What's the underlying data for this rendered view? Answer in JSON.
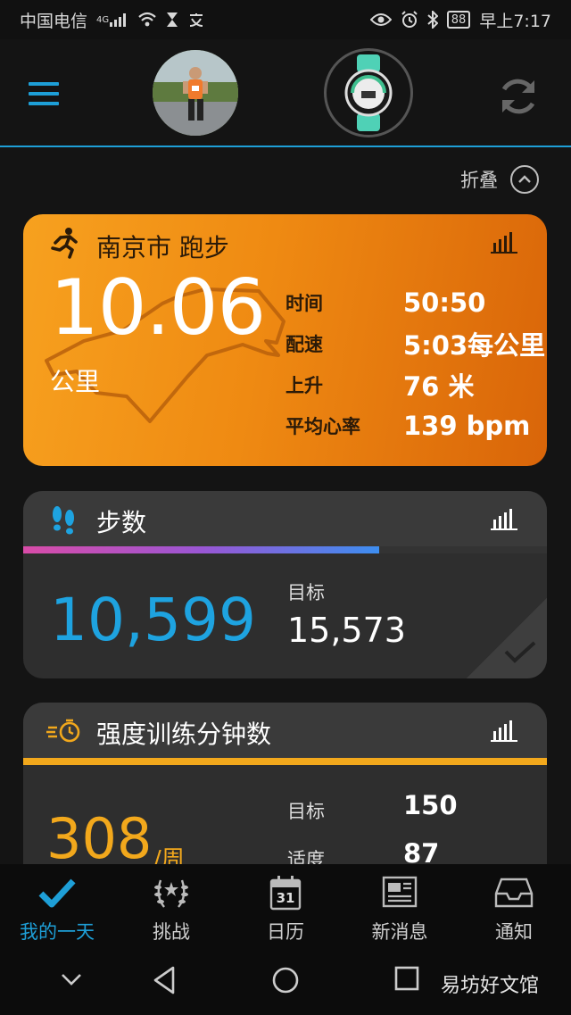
{
  "status_bar": {
    "carrier": "中国电信",
    "network": "4G",
    "battery": "88",
    "time": "早上7:17"
  },
  "header": {
    "menu_icon": "hamburger-icon",
    "sync_icon": "sync-icon"
  },
  "collapse": {
    "label": "折叠"
  },
  "run_card": {
    "title": "南京市 跑步",
    "distance": "10.06",
    "unit": "公里",
    "stats": [
      {
        "label": "时间",
        "value": "50:50"
      },
      {
        "label": "配速",
        "value": "5:03每公里"
      },
      {
        "label": "上升",
        "value": "76 米"
      },
      {
        "label": "平均心率",
        "value": "139 bpm"
      }
    ],
    "color": "#f39019"
  },
  "steps_card": {
    "title": "步数",
    "count": "10,599",
    "goal_label": "目标",
    "goal_value": "15,573",
    "progress": 0.68,
    "color": "#1ea3e0"
  },
  "intensity_card": {
    "title": "强度训练分钟数",
    "minutes": "308",
    "per": "/周",
    "rows": [
      {
        "label": "目标",
        "value": "150"
      },
      {
        "label": "适度",
        "value": "87"
      }
    ],
    "color": "#f2a81c"
  },
  "bottom_nav": [
    {
      "label": "我的一天",
      "icon": "check-icon",
      "active": true
    },
    {
      "label": "挑战",
      "icon": "laurel-icon",
      "active": false
    },
    {
      "label": "日历",
      "icon": "calendar-icon",
      "active": false,
      "day": "31"
    },
    {
      "label": "新消息",
      "icon": "newspaper-icon",
      "active": false
    },
    {
      "label": "通知",
      "icon": "inbox-icon",
      "active": false
    }
  ],
  "watermark": "易坊好文馆",
  "accent": "#1e9fd7"
}
